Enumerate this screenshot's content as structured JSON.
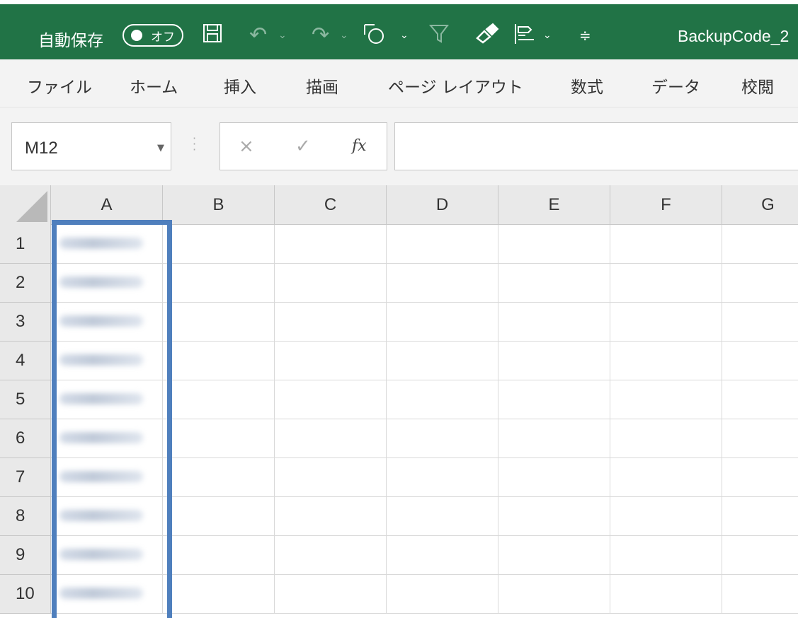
{
  "titlebar": {
    "autosave_label": "自動保存",
    "autosave_state": "オフ",
    "filename": "BackupCode_2",
    "icons": [
      "save-icon",
      "undo-icon",
      "redo-icon",
      "shape-icon",
      "filter-icon",
      "format-painter-icon",
      "align-icon",
      "customize-qat-icon"
    ]
  },
  "ribbon": {
    "tabs": [
      "ファイル",
      "ホーム",
      "挿入",
      "描画",
      "ページ レイアウト",
      "数式",
      "データ",
      "校閲"
    ]
  },
  "formula_bar": {
    "name_box": "M12",
    "cancel_glyph": "×",
    "enter_glyph": "✓",
    "fx_label": "fx",
    "formula_value": ""
  },
  "grid": {
    "columns": [
      "A",
      "B",
      "C",
      "D",
      "E",
      "F",
      "G"
    ],
    "rows": [
      "1",
      "2",
      "3",
      "4",
      "5",
      "6",
      "7",
      "8",
      "9",
      "10"
    ],
    "highlighted_column": "A"
  },
  "colors": {
    "excel_green": "#217346",
    "highlight_border": "#4f7fbd"
  }
}
